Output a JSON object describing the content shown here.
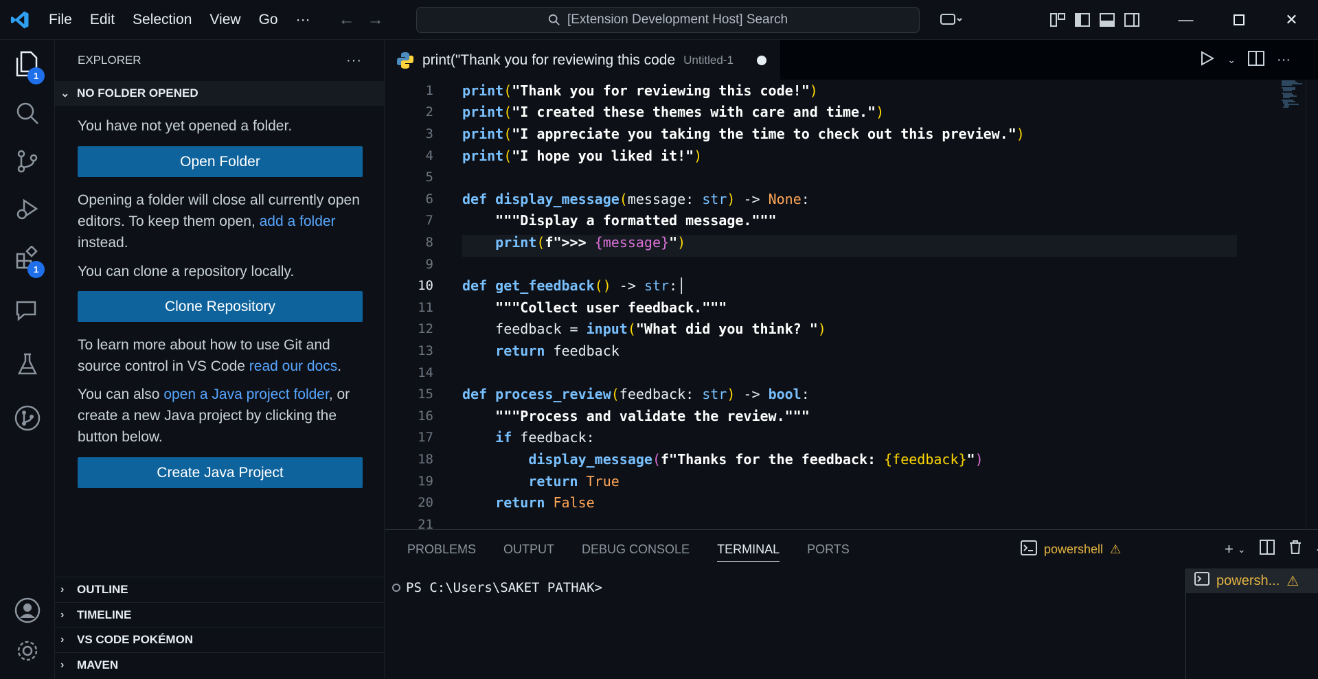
{
  "menu": [
    "File",
    "Edit",
    "Selection",
    "View",
    "Go",
    "···"
  ],
  "search": {
    "text": "[Extension Development Host] Search"
  },
  "activity_badges": {
    "explorer": "1",
    "extensions": "1"
  },
  "sidebar": {
    "title": "EXPLORER",
    "section": "NO FOLDER OPENED",
    "msg1": "You have not yet opened a folder.",
    "open_folder": "Open Folder",
    "msg2a": "Opening a folder will close all currently open editors. To keep them open, ",
    "msg2_link": "add a folder",
    "msg2b": " instead.",
    "msg3": "You can clone a repository locally.",
    "clone": "Clone Repository",
    "msg4a": "To learn more about how to use Git and source control in VS Code ",
    "msg4_link": "read our docs",
    "msg4b": ".",
    "msg5a": "You can also ",
    "msg5_link": "open a Java project folder",
    "msg5b": ", or create a new Java project by clicking the button below.",
    "create_java": "Create Java Project",
    "collapsed": [
      "OUTLINE",
      "TIMELINE",
      "VS CODE POKÉMON",
      "MAVEN"
    ]
  },
  "tab": {
    "name": "print(\"Thank you for reviewing this code",
    "desc": "Untitled-1"
  },
  "line_numbers": [
    "1",
    "2",
    "3",
    "4",
    "5",
    "6",
    "7",
    "8",
    "9",
    "10",
    "11",
    "12",
    "13",
    "14",
    "15",
    "16",
    "17",
    "18",
    "19",
    "20",
    "21"
  ],
  "code": {
    "l1_str": "\"Thank you for reviewing this code!\"",
    "l2_str": "\"I created these themes with care and time.\"",
    "l3_str": "\"I appreciate you taking the time to check out this preview.\"",
    "l4_str": "\"I hope you liked it!\"",
    "print": "print",
    "def": "def",
    "f1": "display_message",
    "f2": "get_feedback",
    "f3": "process_review",
    "message": "message",
    "str": "str",
    "none": "None",
    "doc1": "\"\"\"Display a formatted message.\"\"\"",
    "l8_f": "f\">>> ",
    "l8_var": "{message}",
    "doc2": "\"\"\"Collect user feedback.\"\"\"",
    "l12a": "feedback = ",
    "input": "input",
    "l12_str": "\"What did you think? \"",
    "return": "return",
    "feedback": "feedback",
    "bool": "bool",
    "doc3": "\"\"\"Process and validate the review.\"\"\"",
    "if": "if",
    "l17b": " feedback:",
    "l18_str": "f\"Thanks for the feedback: ",
    "l18_var": "{feedback}",
    "true": "True",
    "false": "False",
    "arrow": " -> ",
    "colon": ":"
  },
  "panel": {
    "tabs": [
      "PROBLEMS",
      "OUTPUT",
      "DEBUG CONSOLE",
      "TERMINAL",
      "PORTS"
    ],
    "active": "TERMINAL",
    "shell": "powershell",
    "prompt": "PS C:\\Users\\SAKET PATHAK>",
    "term_item": "powersh..."
  }
}
